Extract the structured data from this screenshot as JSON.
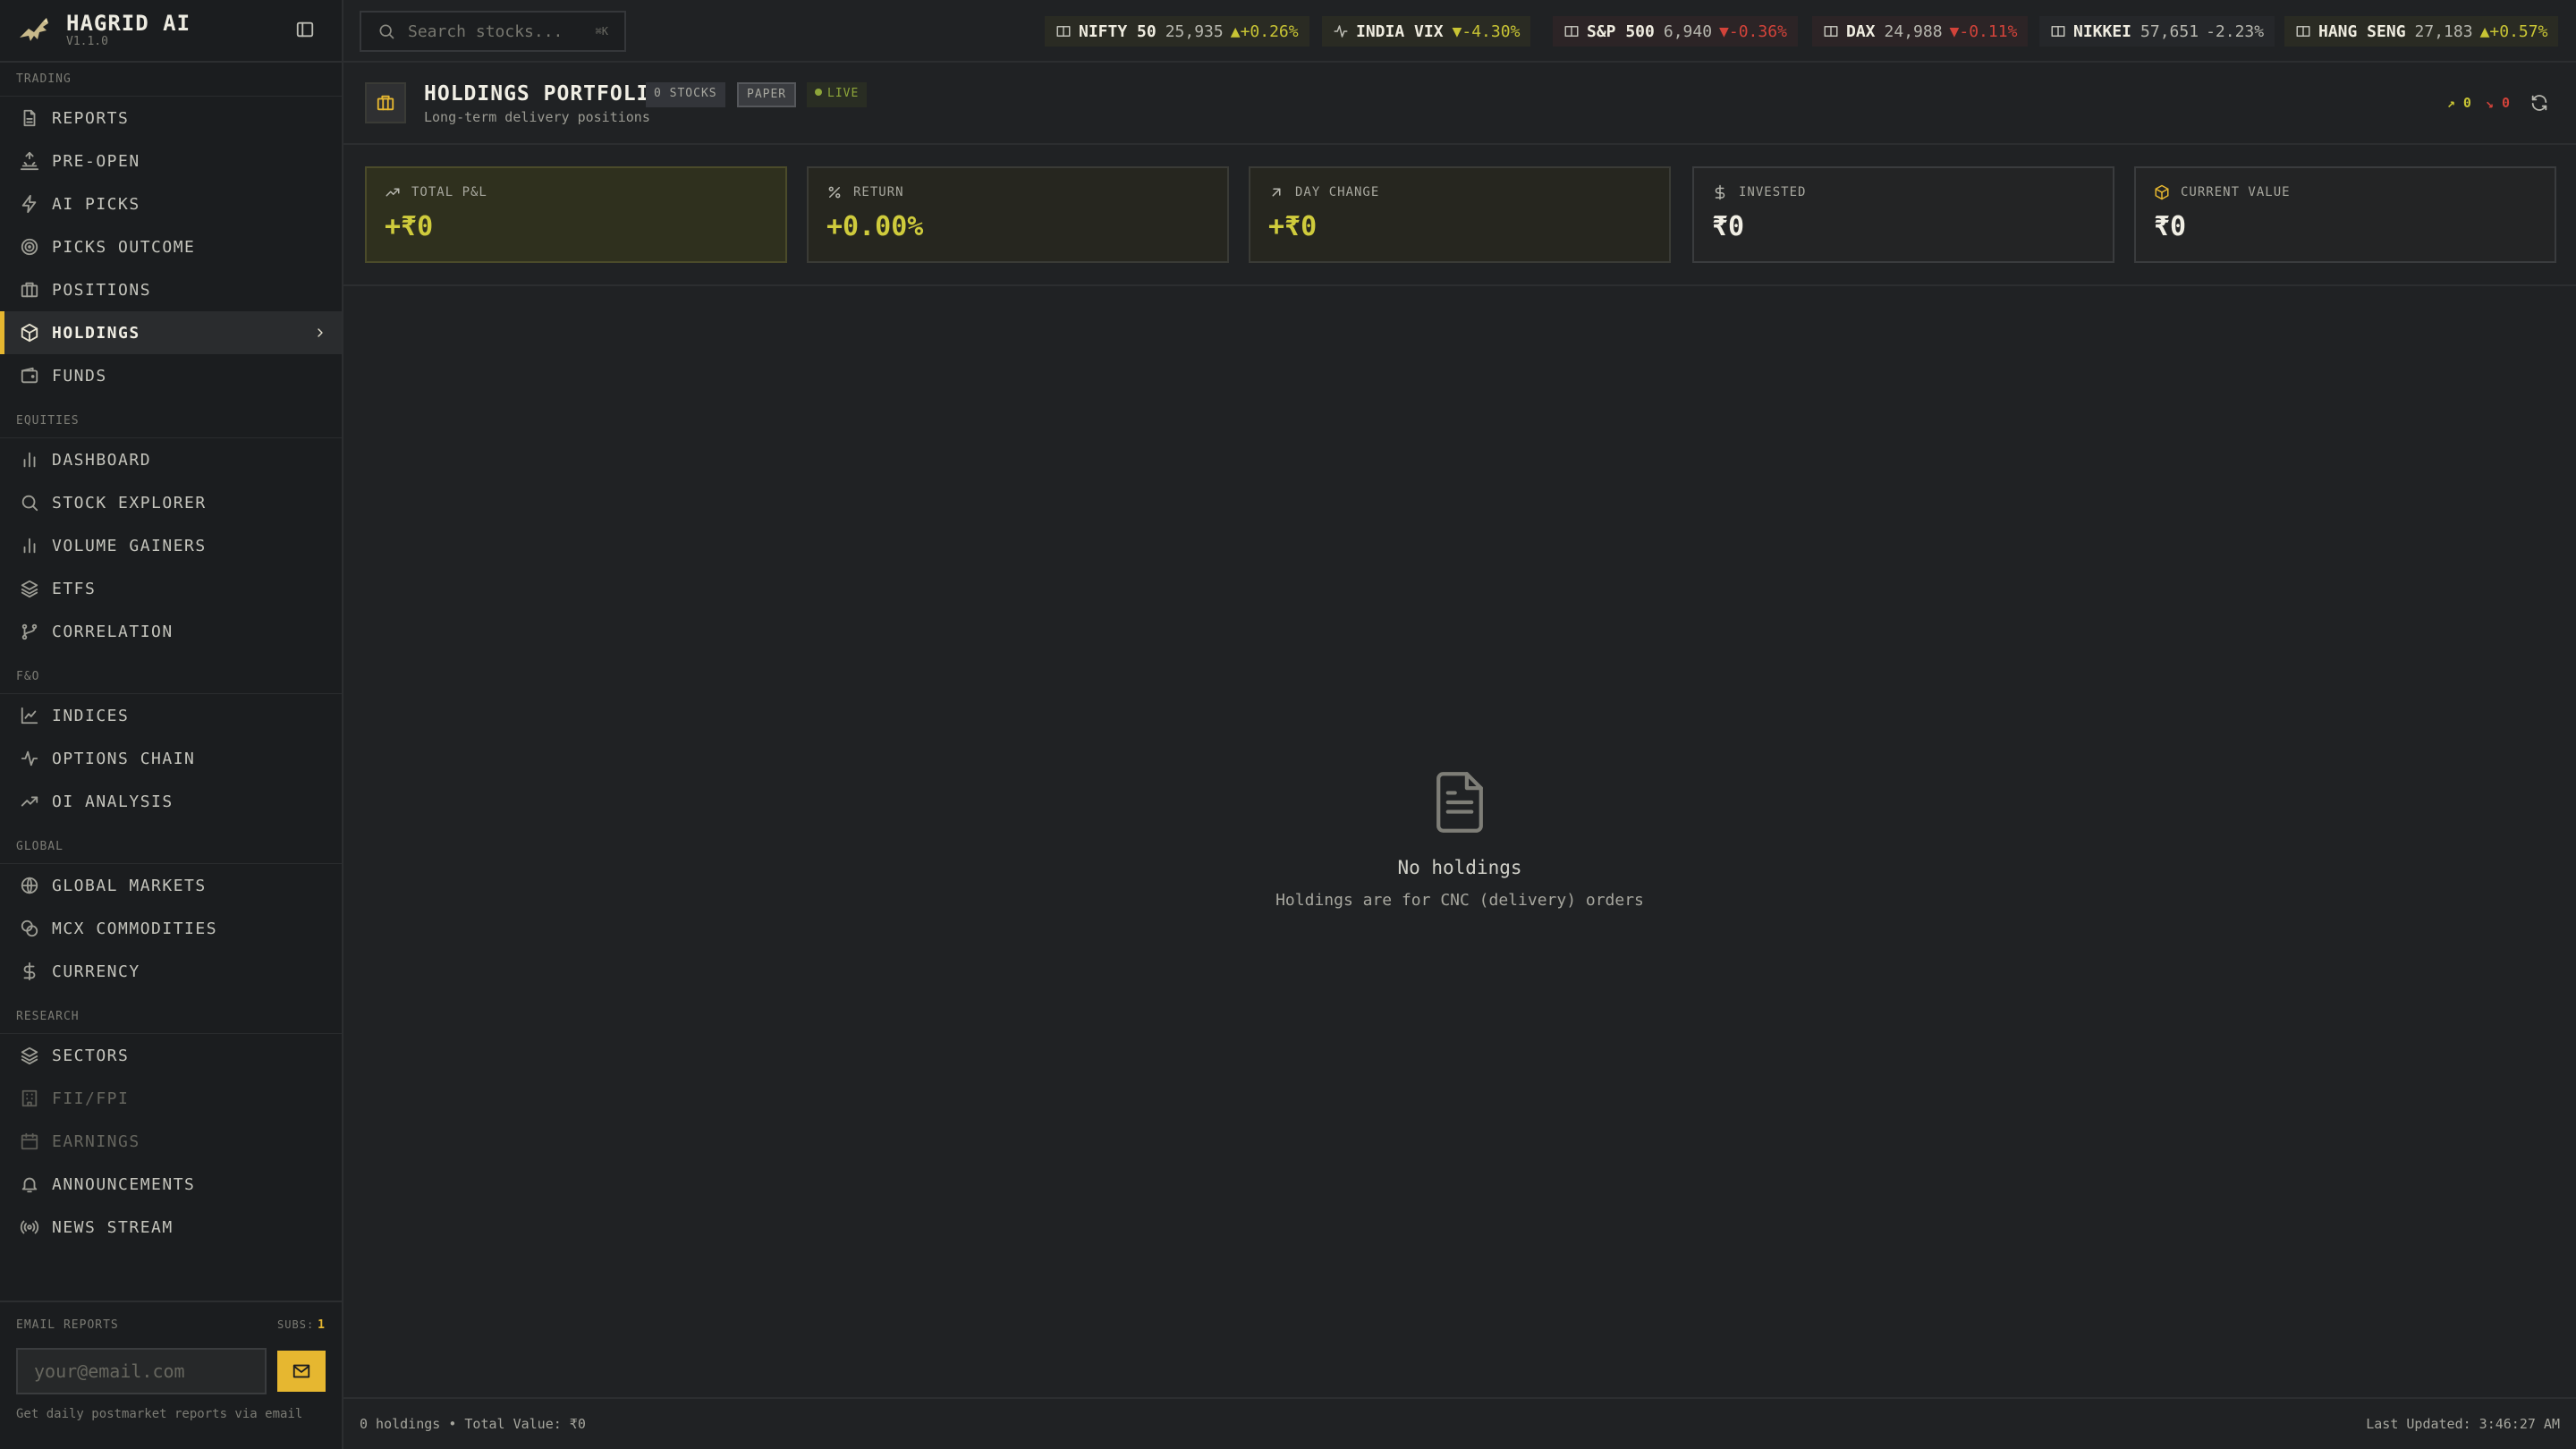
{
  "brand": {
    "name": "HAGRID AI",
    "version": "V1.1.0"
  },
  "sidebar": {
    "sections": [
      {
        "label": "TRADING",
        "items": [
          {
            "label": "REPORTS",
            "icon": "file-text-icon"
          },
          {
            "label": "PRE-OPEN",
            "icon": "sunrise-icon"
          },
          {
            "label": "AI PICKS",
            "icon": "zap-icon"
          },
          {
            "label": "PICKS OUTCOME",
            "icon": "target-icon"
          },
          {
            "label": "POSITIONS",
            "icon": "briefcase-icon"
          },
          {
            "label": "HOLDINGS",
            "icon": "package-icon",
            "active": true
          },
          {
            "label": "FUNDS",
            "icon": "wallet-icon"
          }
        ]
      },
      {
        "label": "EQUITIES",
        "items": [
          {
            "label": "DASHBOARD",
            "icon": "bar-chart-icon"
          },
          {
            "label": "STOCK EXPLORER",
            "icon": "search-icon"
          },
          {
            "label": "VOLUME GAINERS",
            "icon": "bar-chart-icon"
          },
          {
            "label": "ETFS",
            "icon": "layers-icon"
          },
          {
            "label": "CORRELATION",
            "icon": "git-branch-icon"
          }
        ]
      },
      {
        "label": "F&O",
        "items": [
          {
            "label": "INDICES",
            "icon": "line-chart-icon"
          },
          {
            "label": "OPTIONS CHAIN",
            "icon": "activity-icon"
          },
          {
            "label": "OI ANALYSIS",
            "icon": "trending-up-icon"
          }
        ]
      },
      {
        "label": "GLOBAL",
        "items": [
          {
            "label": "GLOBAL MARKETS",
            "icon": "globe-icon"
          },
          {
            "label": "MCX COMMODITIES",
            "icon": "coins-icon"
          },
          {
            "label": "CURRENCY",
            "icon": "dollar-icon"
          }
        ]
      },
      {
        "label": "RESEARCH",
        "items": [
          {
            "label": "SECTORS",
            "icon": "layers-icon"
          },
          {
            "label": "FII/FPI",
            "icon": "building-icon",
            "disabled": true
          },
          {
            "label": "EARNINGS",
            "icon": "calendar-icon",
            "disabled": true
          },
          {
            "label": "ANNOUNCEMENTS",
            "icon": "bell-icon"
          },
          {
            "label": "NEWS STREAM",
            "icon": "radio-icon"
          }
        ]
      }
    ]
  },
  "email_reports": {
    "label": "EMAIL REPORTS",
    "subs_label": "SUBS:",
    "subs_count": "1",
    "placeholder": "your@email.com",
    "note": "Get daily postmarket reports via email"
  },
  "topbar": {
    "search_placeholder": "Search stocks...",
    "search_shortcut": "⌘K",
    "tickers": [
      {
        "name": "NIFTY 50",
        "value": "25,935",
        "change": "▲+0.26%",
        "dir": "up",
        "icon": "columns-icon"
      },
      {
        "name": "INDIA VIX",
        "value": "",
        "change": "▼-4.30%",
        "dir": "up",
        "icon": "activity-icon"
      },
      {
        "name": "S&P 500",
        "value": "6,940",
        "change": "▼-0.36%",
        "dir": "down",
        "icon": "columns-icon"
      },
      {
        "name": "DAX",
        "value": "24,988",
        "change": "▼-0.11%",
        "dir": "down",
        "icon": "columns-icon"
      },
      {
        "name": "NIKKEI",
        "value": "57,651",
        "change": "-2.23%",
        "dir": "flat",
        "icon": "columns-icon"
      },
      {
        "name": "HANG SENG",
        "value": "27,183",
        "change": "▲+0.57%",
        "dir": "up",
        "icon": "columns-icon"
      }
    ]
  },
  "header": {
    "title": "HOLDINGS PORTFOLIO",
    "subtitle": "Long-term delivery positions",
    "badge_stocks": "0 STOCKS",
    "badge_paper": "PAPER",
    "badge_live": "LIVE",
    "gainers": "↗ 0",
    "losers": "↘ 0"
  },
  "stats": [
    {
      "label": "TOTAL P&L",
      "value": "+₹0",
      "icon": "trending-up-icon"
    },
    {
      "label": "RETURN",
      "value": "+0.00%",
      "icon": "percent-icon"
    },
    {
      "label": "DAY CHANGE",
      "value": "+₹0",
      "icon": "arrow-up-right-icon"
    },
    {
      "label": "INVESTED",
      "value": "₹0",
      "icon": "dollar-icon"
    },
    {
      "label": "CURRENT VALUE",
      "value": "₹0",
      "icon": "package-icon"
    }
  ],
  "empty_state": {
    "title": "No holdings",
    "message": "Holdings are for CNC (delivery) orders"
  },
  "footer": {
    "summary": "0 holdings • Total Value: ₹0",
    "updated": "Last Updated: 3:46:27 AM"
  },
  "colors": {
    "accent": "#e6b730",
    "positive": "#c8c434",
    "negative": "#d2433a"
  }
}
